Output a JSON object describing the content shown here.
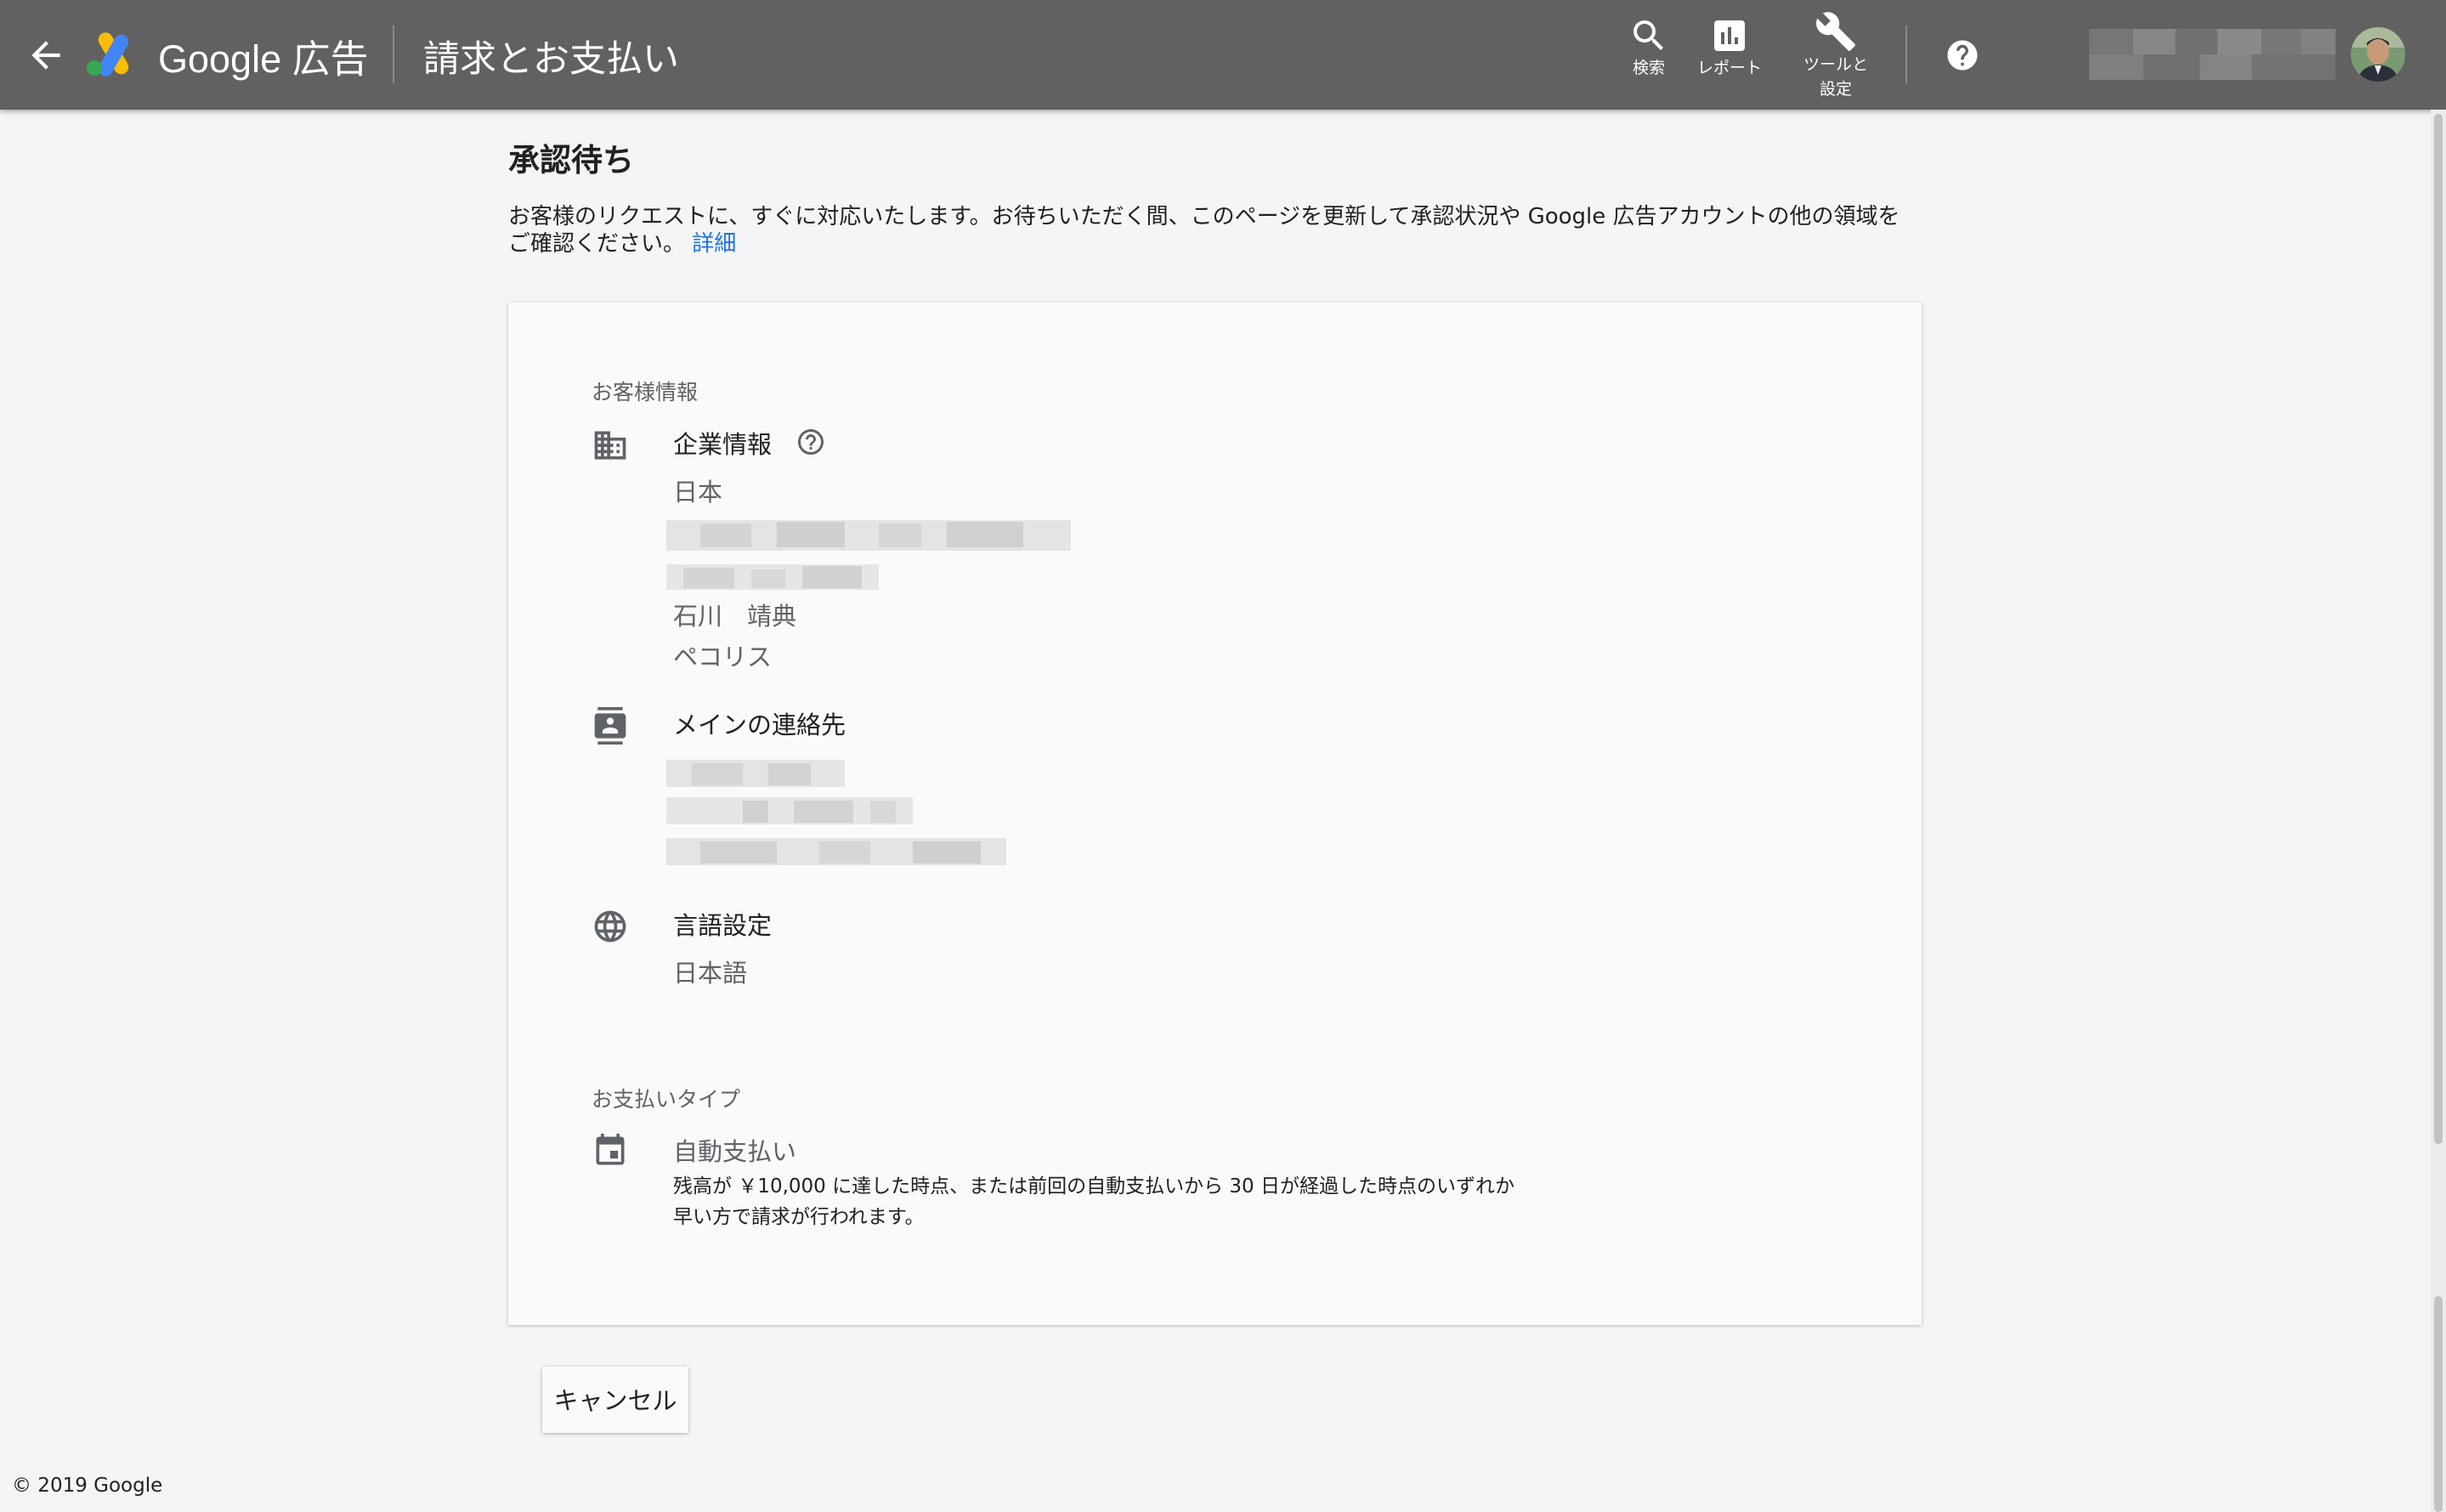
{
  "header": {
    "back_label": "back",
    "brand": "Google 広告",
    "page_title": "請求とお支払い",
    "nav": [
      {
        "label": "検索",
        "icon": "search-icon"
      },
      {
        "label": "レポート",
        "icon": "reports-icon"
      },
      {
        "label": "ツールと\n設定",
        "icon": "wrench-icon"
      }
    ],
    "help_icon": "help-icon"
  },
  "main": {
    "title": "承認待ち",
    "description": "お客様のリクエストに、すぐに対応いたします。お待ちいただく間、このページを更新して承認状況や Google 広告アカウントの他の領域をご確認ください。",
    "details_link": "詳細"
  },
  "card": {
    "customer_section_label": "お客様情報",
    "business": {
      "title": "企業情報",
      "country": "日本",
      "contact_name": "石川　靖典",
      "company": "ペコリス"
    },
    "primary_contact": {
      "title": "メインの連絡先"
    },
    "language": {
      "title": "言語設定",
      "value": "日本語"
    },
    "payment_section_label": "お支払いタイプ",
    "payment": {
      "type": "自動支払い",
      "note": "残高が ￥10,000 に達した時点、または前回の自動支払いから 30 日が経過した時点のいずれか早い方で請求が行われます。"
    }
  },
  "actions": {
    "cancel_label": "キャンセル"
  },
  "footer": {
    "copyright": "© 2019 Google"
  },
  "colors": {
    "header_bg": "#616161",
    "link": "#1a73e8",
    "page_bg": "#f5f5f5"
  }
}
